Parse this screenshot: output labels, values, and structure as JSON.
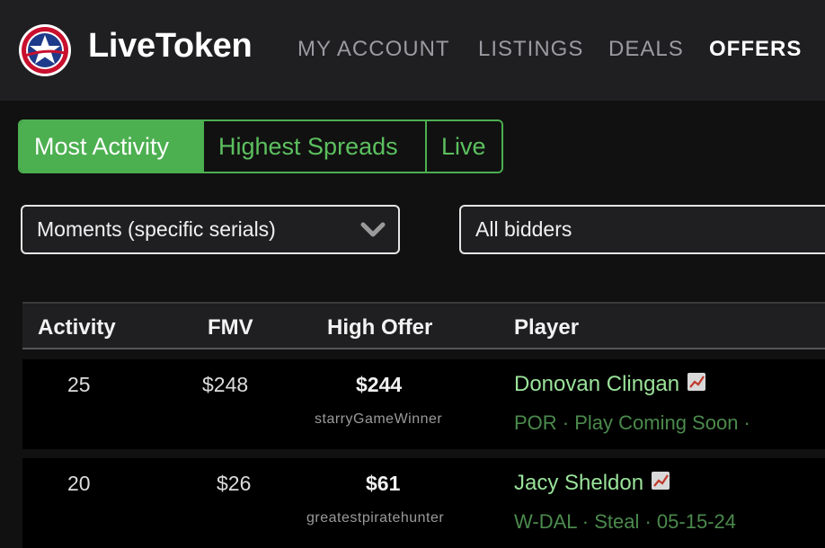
{
  "brand": {
    "name": "LiveToken"
  },
  "nav": [
    {
      "label": "MY ACCOUNT",
      "active": false
    },
    {
      "label": "LISTINGS",
      "active": false
    },
    {
      "label": "DEALS",
      "active": false
    },
    {
      "label": "OFFERS",
      "active": true
    }
  ],
  "tabs": [
    {
      "label": "Most Activity",
      "active": true
    },
    {
      "label": "Highest Spreads",
      "active": false
    },
    {
      "label": "Live",
      "active": false
    }
  ],
  "filters": {
    "type_select": "Moments (specific serials)",
    "bidder_select": "All bidders"
  },
  "table": {
    "headers": [
      "Activity",
      "FMV",
      "High Offer",
      "Player"
    ],
    "rows": [
      {
        "activity": "25",
        "fmv": "$248",
        "high_offer": "$244",
        "bidder": "starryGameWinner",
        "player": "Donovan Clingan",
        "meta": "POR · Play Coming Soon ·"
      },
      {
        "activity": "20",
        "fmv": "$26",
        "high_offer": "$61",
        "bidder": "greatestpiratehunter",
        "player": "Jacy Sheldon",
        "meta": "W-DAL · Steal · 05-15-24"
      }
    ]
  },
  "colors": {
    "accent_green": "#4caf50",
    "player_green": "#9be39b",
    "meta_green": "#4b8a4d",
    "header_bg": "#1f1f21"
  },
  "icons": {
    "logo": "star-shield-icon",
    "chevron": "chevron-down-icon",
    "trend": "trending-chart-icon"
  }
}
